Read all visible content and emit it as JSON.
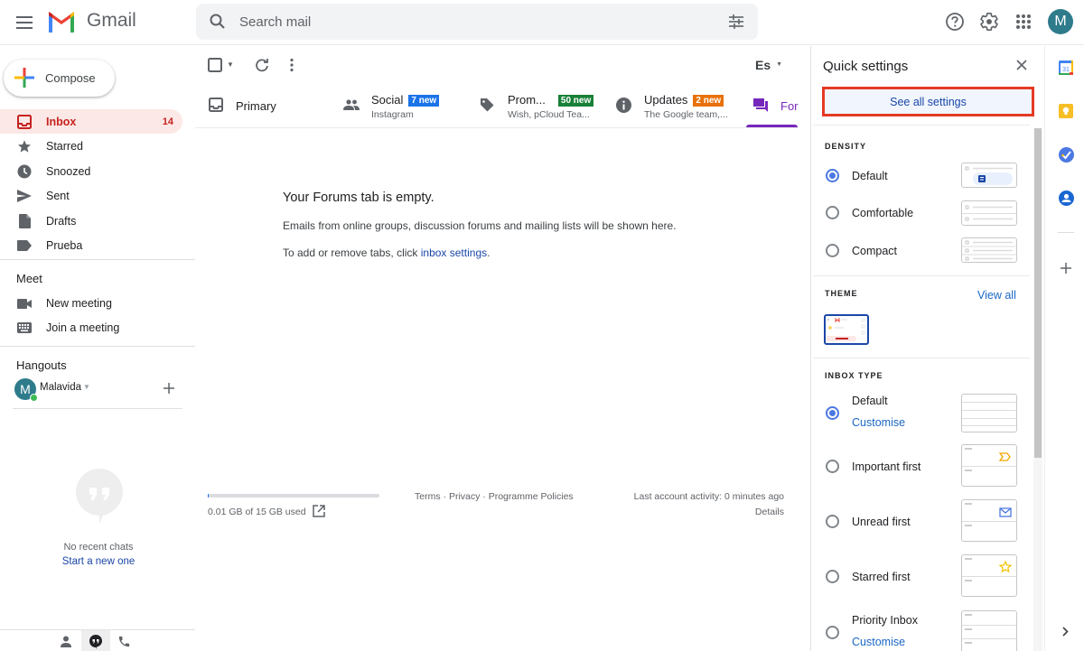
{
  "header": {
    "app_name": "Gmail",
    "search_placeholder": "Search mail",
    "avatar_letter": "M",
    "icons": [
      "menu-icon",
      "search-icon",
      "filter-options-icon",
      "help-icon",
      "settings-gear-icon",
      "apps-grid-icon"
    ]
  },
  "sidebar": {
    "compose_label": "Compose",
    "items": [
      {
        "label": "Inbox",
        "count": "14",
        "icon": "inbox-icon",
        "active": true
      },
      {
        "label": "Starred",
        "icon": "star-icon"
      },
      {
        "label": "Snoozed",
        "icon": "clock-icon"
      },
      {
        "label": "Sent",
        "icon": "send-icon"
      },
      {
        "label": "Drafts",
        "icon": "draft-icon"
      },
      {
        "label": "Prueba",
        "icon": "label-icon"
      }
    ],
    "meet": {
      "title": "Meet",
      "items": [
        {
          "label": "New meeting",
          "icon": "video-camera-icon"
        },
        {
          "label": "Join a meeting",
          "icon": "keyboard-icon"
        }
      ]
    },
    "hangouts": {
      "title": "Hangouts",
      "user_letter": "M",
      "user_name": "Malavida",
      "no_chats": "No recent chats",
      "start_new": "Start a new one"
    }
  },
  "toolbar": {
    "language_indicator": "Es"
  },
  "tabs": [
    {
      "title": "Primary",
      "icon": "inbox-icon"
    },
    {
      "title": "Social",
      "badge": "7 new",
      "badge_color": "#1a73e8",
      "subtitle": "Instagram",
      "icon": "people-icon"
    },
    {
      "title": "Prom...",
      "badge": "50 new",
      "badge_color": "#188038",
      "subtitle": "Wish, pCloud Tea...",
      "icon": "tag-icon"
    },
    {
      "title": "Updates",
      "badge": "2 new",
      "badge_color": "#e8710a",
      "subtitle": "The Google team,...",
      "icon": "info-icon"
    },
    {
      "title": "For",
      "icon": "forum-icon",
      "active": true,
      "color": "#7627bb"
    }
  ],
  "main": {
    "empty_title": "Your Forums tab is empty.",
    "empty_desc": "Emails from online groups, discussion forums and mailing lists will be shown here.",
    "add_remove_prefix": "To add or remove tabs, click ",
    "inbox_settings_link": "inbox settings",
    "add_remove_suffix": "."
  },
  "footer": {
    "storage_used": "0.01 GB of 15 GB used",
    "storage_fraction": 0.0007,
    "terms": "Terms",
    "privacy": "Privacy",
    "policies": "Programme Policies",
    "sep": " · ",
    "last_activity": "Last account activity: 0 minutes ago",
    "details": "Details"
  },
  "quick_settings": {
    "title": "Quick settings",
    "see_all": "See all settings",
    "density": {
      "label": "DENSITY",
      "options": [
        {
          "label": "Default",
          "selected": true
        },
        {
          "label": "Comfortable",
          "selected": false
        },
        {
          "label": "Compact",
          "selected": false
        }
      ]
    },
    "theme": {
      "label": "THEME",
      "view_all": "View all"
    },
    "inbox_type": {
      "label": "INBOX TYPE",
      "customise": "Customise",
      "options": [
        {
          "label": "Default",
          "selected": true
        },
        {
          "label": "Important first",
          "selected": false
        },
        {
          "label": "Unread first",
          "selected": false
        },
        {
          "label": "Starred first",
          "selected": false
        },
        {
          "label": "Priority Inbox",
          "selected": false
        }
      ]
    }
  },
  "right_rail": {
    "apps": [
      "calendar-icon",
      "keep-icon",
      "tasks-icon",
      "contacts-icon"
    ],
    "calendar_day": "31"
  }
}
